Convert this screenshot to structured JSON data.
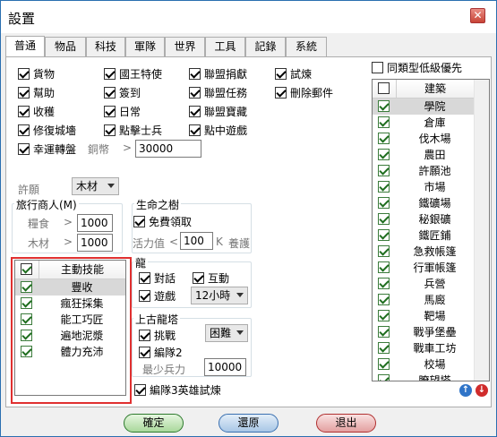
{
  "window": {
    "title": "設置",
    "close": "✕"
  },
  "tabs": [
    "普通",
    "物品",
    "科技",
    "軍隊",
    "世界",
    "工具",
    "記錄",
    "系統"
  ],
  "checks": {
    "huowu": "貨物",
    "guowang": "國王特使",
    "lianmeng_juanxian": "聯盟捐獻",
    "shilian": "試煉",
    "bangzhu": "幫助",
    "qiandao": "簽到",
    "lianmeng_renwu": "聯盟任務",
    "shanchu_youjian": "刪除郵件",
    "shouhuo": "收穫",
    "richang": "日常",
    "lianmeng_baozang": "聯盟寶藏",
    "xiufu_chengqiang": "修復城墻",
    "dianji_shibing": "點擊士兵",
    "dianzhong_youxi": "點中遊戲",
    "xingyun_zhuanpan": "幸運轉盤"
  },
  "lucky": {
    "label": "銅幣",
    "op": ">",
    "value": "30000"
  },
  "wish": {
    "label": "許願",
    "value": "木材"
  },
  "trader": {
    "title": "旅行商人(M)",
    "food": "糧食",
    "wood": "木材",
    "op": ">",
    "food_value": "1000",
    "wood_value": "1000"
  },
  "tree": {
    "title": "生命之樹",
    "free": "免費領取",
    "vitality": "活力值",
    "op": "<",
    "value": "100",
    "unit": "K",
    "suffix": "養護"
  },
  "skills": {
    "header": "主動技能",
    "items": [
      "豐收",
      "瘋狂採集",
      "能工巧匠",
      "遍地泥漿",
      "體力充沛"
    ]
  },
  "dragon": {
    "title": "龍",
    "talk": "對話",
    "interact": "互動",
    "play": "遊戲",
    "play_interval": "12小時"
  },
  "ancient": {
    "title": "上古龍塔",
    "challenge": "挑戰",
    "difficulty": "困難",
    "squad2": "編隊2",
    "min_troops_label": "最少兵力",
    "min_troops": "10000"
  },
  "hero_trial": "編隊3英雄試煉",
  "low_priority": "同類型低級優先",
  "buildings": {
    "header": "建築",
    "items": [
      "學院",
      "倉庫",
      "伐木場",
      "農田",
      "許願池",
      "市場",
      "鐵礦場",
      "秘銀礦",
      "鐵匠鋪",
      "急救帳篷",
      "行軍帳篷",
      "兵營",
      "馬廄",
      "靶場",
      "戰爭堡壘",
      "戰車工坊",
      "校場",
      "瞭望塔"
    ]
  },
  "buttons": {
    "ok": "確定",
    "reset": "還原",
    "exit": "退出"
  },
  "icons": {
    "up": "↑",
    "down": "↓"
  }
}
